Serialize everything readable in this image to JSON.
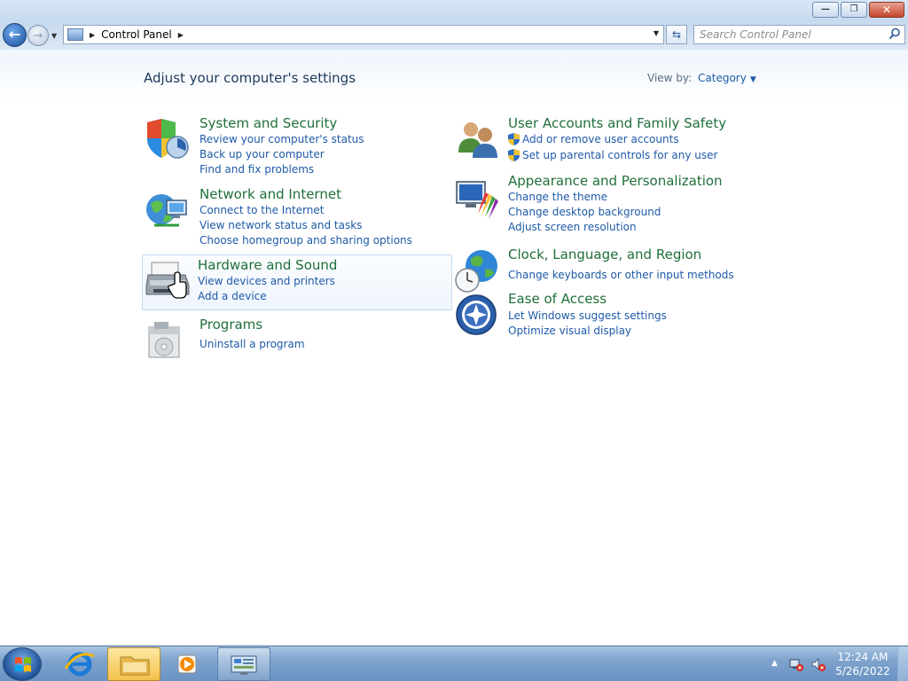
{
  "window": {
    "minimize_glyph": "—",
    "restore_glyph": "❐",
    "close_glyph": "✕"
  },
  "nav": {
    "back_glyph": "←",
    "forward_glyph": "→",
    "dropdown_glyph": "▼",
    "breadcrumb_sep": "▶",
    "breadcrumb": [
      "Control Panel"
    ],
    "refresh_glyph": "⇆",
    "search_placeholder": "Search Control Panel"
  },
  "content": {
    "heading": "Adjust your computer's settings",
    "view_by_label": "View by:",
    "view_by_value": "Category",
    "view_by_arrow": "▼"
  },
  "categories": {
    "system_security": {
      "title": "System and Security",
      "links": [
        "Review your computer's status",
        "Back up your computer",
        "Find and fix problems"
      ]
    },
    "network_internet": {
      "title": "Network and Internet",
      "links": [
        "Connect to the Internet",
        "View network status and tasks",
        "Choose homegroup and sharing options"
      ]
    },
    "hardware_sound": {
      "title": "Hardware and Sound",
      "links": [
        "View devices and printers",
        "Add a device"
      ]
    },
    "programs": {
      "title": "Programs",
      "links": [
        "Uninstall a program"
      ]
    },
    "user_accounts": {
      "title": "User Accounts and Family Safety",
      "links": [
        "Add or remove user accounts",
        "Set up parental controls for any user"
      ]
    },
    "appearance": {
      "title": "Appearance and Personalization",
      "links": [
        "Change the theme",
        "Change desktop background",
        "Adjust screen resolution"
      ]
    },
    "clock_region": {
      "title": "Clock, Language, and Region",
      "links": [
        "Change keyboards or other input methods"
      ]
    },
    "ease_access": {
      "title": "Ease of Access",
      "links": [
        "Let Windows suggest settings",
        "Optimize visual display"
      ]
    }
  },
  "taskbar": {
    "tray_arrow": "▲",
    "time": "12:24 AM",
    "date": "5/26/2022"
  },
  "colors": {
    "link": "#1e5aa8",
    "category_title": "#1f6f3a",
    "heading": "#1e395b"
  }
}
